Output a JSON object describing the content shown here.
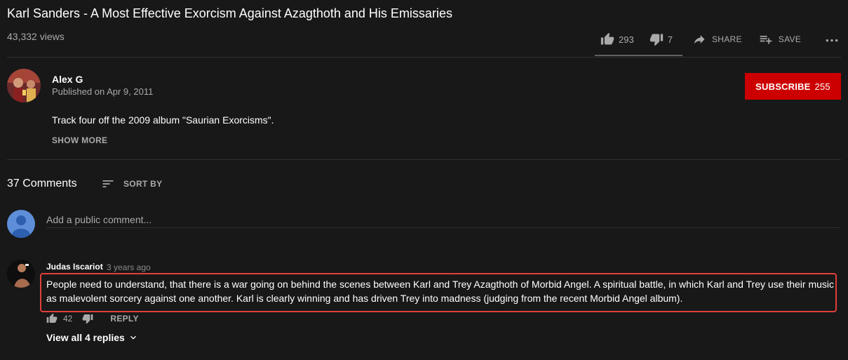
{
  "video": {
    "title": "Karl Sanders - A Most Effective Exorcism Against Azagthoth and His Emissaries",
    "views": "43,332 views"
  },
  "actions": {
    "like_count": "293",
    "dislike_count": "7",
    "share_label": "SHARE",
    "save_label": "SAVE",
    "icons": [
      "thumb-up-icon",
      "thumb-down-icon",
      "share-icon",
      "playlist-add-icon",
      "more-icon"
    ]
  },
  "channel": {
    "name": "Alex G",
    "published": "Published on Apr 9, 2011",
    "subscribe_label": "SUBSCRIBE",
    "subscriber_count": "255"
  },
  "description": {
    "text": "Track four off the 2009 album \"Saurian Exorcisms\".",
    "show_more_label": "SHOW MORE"
  },
  "comments": {
    "count_label": "37 Comments",
    "sort_label": "SORT BY",
    "add_placeholder": "Add a public comment...",
    "items": [
      {
        "author": "Judas Iscariot",
        "time": "3 years ago",
        "text": "People need to understand, that there is a war going on behind the scenes between Karl and Trey Azagthoth of Morbid Angel. A spiritual battle, in which Karl and Trey use their music as malevolent sorcery against one another. Karl is clearly winning and has driven Trey into madness (judging from the recent Morbid Angel album).",
        "likes": "42",
        "reply_label": "REPLY",
        "view_replies_label": "View all 4 replies"
      }
    ]
  },
  "colors": {
    "background": "#181818",
    "subscribe": "#cc0000",
    "secondary_text": "#aaaaaa",
    "highlight_border": "#e0403a"
  }
}
